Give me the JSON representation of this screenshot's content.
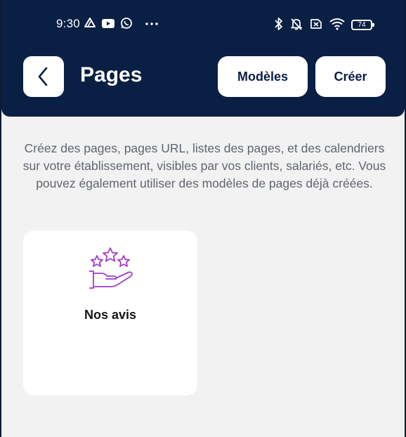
{
  "status_bar": {
    "time": "9:30",
    "left_icons": [
      "drive-icon",
      "youtube-icon",
      "whatsapp-icon",
      "more-dots-icon"
    ],
    "right_icons": [
      "bluetooth-icon",
      "silent-icon",
      "no-sim-icon",
      "wifi-icon"
    ],
    "battery": "74"
  },
  "header": {
    "title": "Pages",
    "back_icon": "chevron-left-icon",
    "templates_label": "Modèles",
    "create_label": "Créer"
  },
  "description": "Créez des pages, pages URL, listes des pages, et des calendriers sur votre établissement, visibles par vos clients, salariés, etc. Vous pouvez également utiliser des modèles de pages déjà créées.",
  "cards": [
    {
      "label": "Nos avis",
      "icon": "rating-stars-hand-icon"
    }
  ],
  "colors": {
    "header_bg": "#0a1f44",
    "page_bg": "#f2f2f2",
    "card_bg": "#ffffff",
    "icon_accent": "#a23cc9",
    "description_text": "#5f6570"
  }
}
